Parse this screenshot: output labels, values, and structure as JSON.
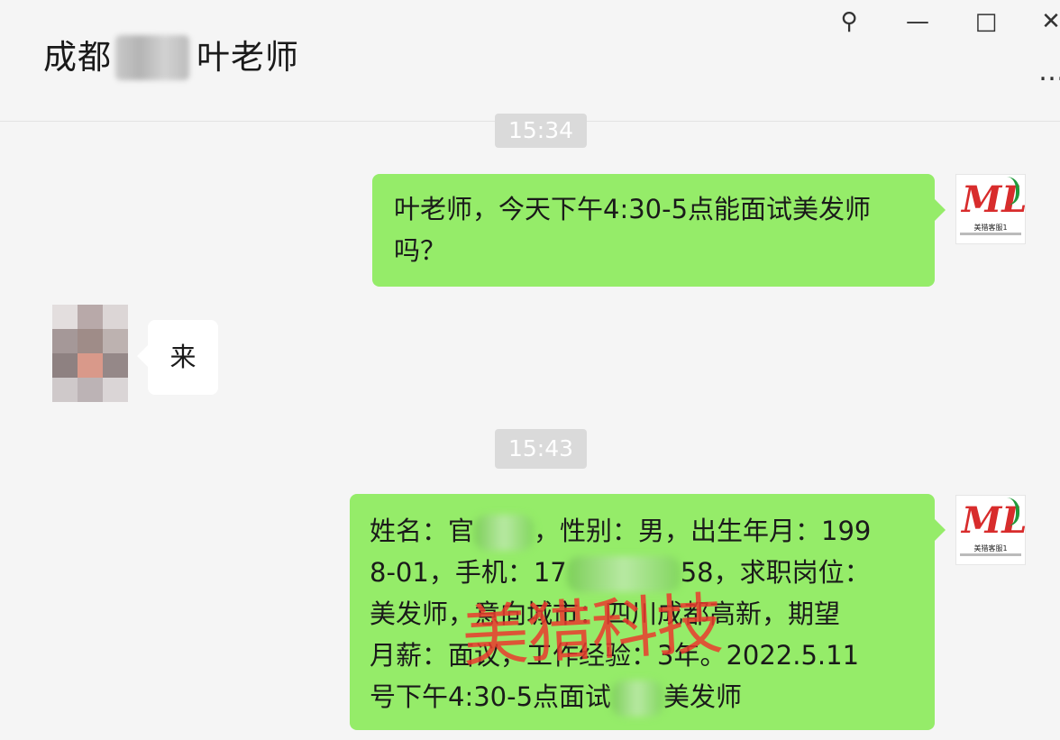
{
  "window": {
    "title_prefix": "成都",
    "title_suffix": "叶老师",
    "controls": {
      "pin": "⚲",
      "minimize": "—",
      "maximize": "□",
      "close": "✕"
    },
    "more": "…"
  },
  "messages": [
    {
      "type": "time",
      "text": "15:34"
    },
    {
      "type": "sent",
      "text": "叶老师，今天下午4:30-5点能面试美发师吗？"
    },
    {
      "type": "received",
      "text": "来"
    },
    {
      "type": "time",
      "text": "15:43"
    },
    {
      "type": "sent",
      "lines": {
        "l1a": "姓名：官",
        "l1b": "，性别：男，出生年月：199",
        "l2a": "8-01，手机：17",
        "l2b": "58，求职岗位：",
        "l3": "美发师，意向城市：四川成都高新，期望",
        "l4": "月薪：面议，工作经验：3年。2022.5.11",
        "l5a": "号下午4:30-5点面试",
        "l5b": "美发师"
      }
    }
  ],
  "logo": {
    "mark": "ML",
    "caption": "美猎客服1"
  },
  "watermark": "美猎科技",
  "colors": {
    "sent_bubble": "#95ec69",
    "received_bubble": "#ffffff",
    "background": "#f5f5f5"
  }
}
